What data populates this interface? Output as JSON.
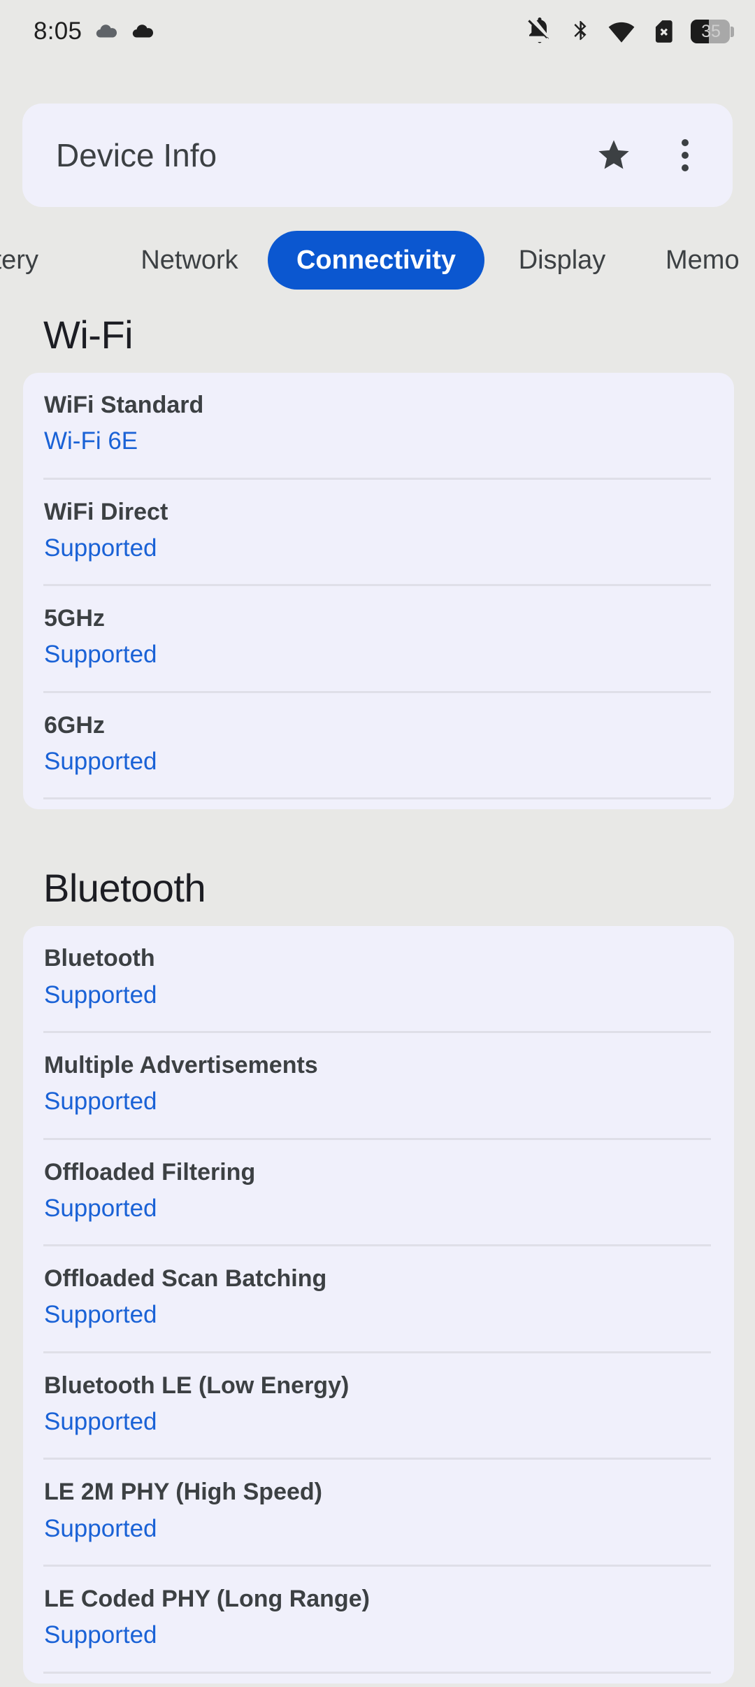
{
  "statusbar": {
    "time": "8:05",
    "left_icons": [
      "cloud-icon",
      "cloud-icon"
    ],
    "right_icons": [
      "notifications-off-icon",
      "bluetooth-icon",
      "wifi-icon",
      "sim-off-icon"
    ],
    "battery_level": "35"
  },
  "appbar": {
    "title": "Device Info",
    "star_label": "star-icon",
    "overflow_label": "more-options-icon"
  },
  "tabs": {
    "items": [
      {
        "label": "ttery",
        "selected": false
      },
      {
        "label": "Network",
        "selected": false
      },
      {
        "label": "Connectivity",
        "selected": true
      },
      {
        "label": "Display",
        "selected": false
      },
      {
        "label": "Memo",
        "selected": false
      }
    ],
    "selected_label": "Connectivity",
    "selected_color": "#0b57d0"
  },
  "sections": [
    {
      "title": "Wi-Fi",
      "rows": [
        {
          "label": "WiFi Standard",
          "value": "Wi-Fi 6E"
        },
        {
          "label": "WiFi Direct",
          "value": "Supported"
        },
        {
          "label": "5GHz",
          "value": "Supported"
        },
        {
          "label": "6GHz",
          "value": "Supported"
        }
      ]
    },
    {
      "title": "Bluetooth",
      "rows": [
        {
          "label": "Bluetooth",
          "value": "Supported"
        },
        {
          "label": "Multiple Advertisements",
          "value": "Supported"
        },
        {
          "label": "Offloaded Filtering",
          "value": "Supported"
        },
        {
          "label": "Offloaded Scan Batching",
          "value": "Supported"
        },
        {
          "label": "Bluetooth LE (Low Energy)",
          "value": "Supported"
        },
        {
          "label": "LE 2M PHY (High Speed)",
          "value": "Supported"
        },
        {
          "label": "LE Coded PHY (Long Range)",
          "value": "Supported"
        }
      ]
    }
  ],
  "colors": {
    "background": "#e8e8e6",
    "card": "#f0f0fb",
    "accent": "#0b57d0",
    "value_text": "#1a62d6",
    "label_text": "#3c4043"
  }
}
